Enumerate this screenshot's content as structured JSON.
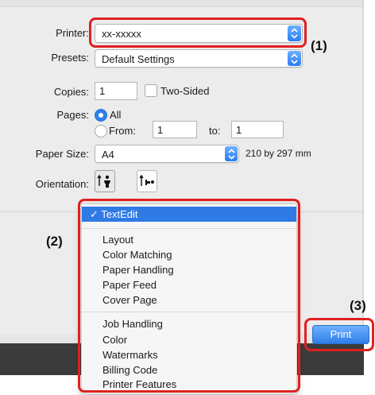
{
  "dialog": {
    "printer": {
      "label": "Printer:",
      "value": "xx-xxxxx"
    },
    "presets": {
      "label": "Presets:",
      "value": "Default Settings"
    },
    "copies": {
      "label": "Copies:",
      "value": "1",
      "two_sided_label": "Two-Sided"
    },
    "pages": {
      "label": "Pages:",
      "all_label": "All",
      "from_label": "From:",
      "from_value": "1",
      "to_label": "to:",
      "to_value": "1"
    },
    "paper_size": {
      "label": "Paper Size:",
      "value": "A4",
      "dimensions": "210 by 297 mm"
    },
    "orientation": {
      "label": "Orientation:",
      "options": [
        "portrait-icon",
        "landscape-icon"
      ],
      "selected": "portrait"
    }
  },
  "menu": {
    "selected": "✓ TextEdit",
    "group1": [
      "Layout",
      "Color Matching",
      "Paper Handling",
      "Paper Feed",
      "Cover Page"
    ],
    "group2": [
      "Job Handling",
      "Color",
      "Watermarks",
      "Billing Code",
      "Printer Features"
    ]
  },
  "print_button": {
    "label": "Print"
  },
  "annotations": {
    "one": "(1)",
    "two": "(2)",
    "three": "(3)",
    "color": "#e02020"
  },
  "colors": {
    "accent": "#2f7ae5",
    "panel": "#ececec"
  }
}
